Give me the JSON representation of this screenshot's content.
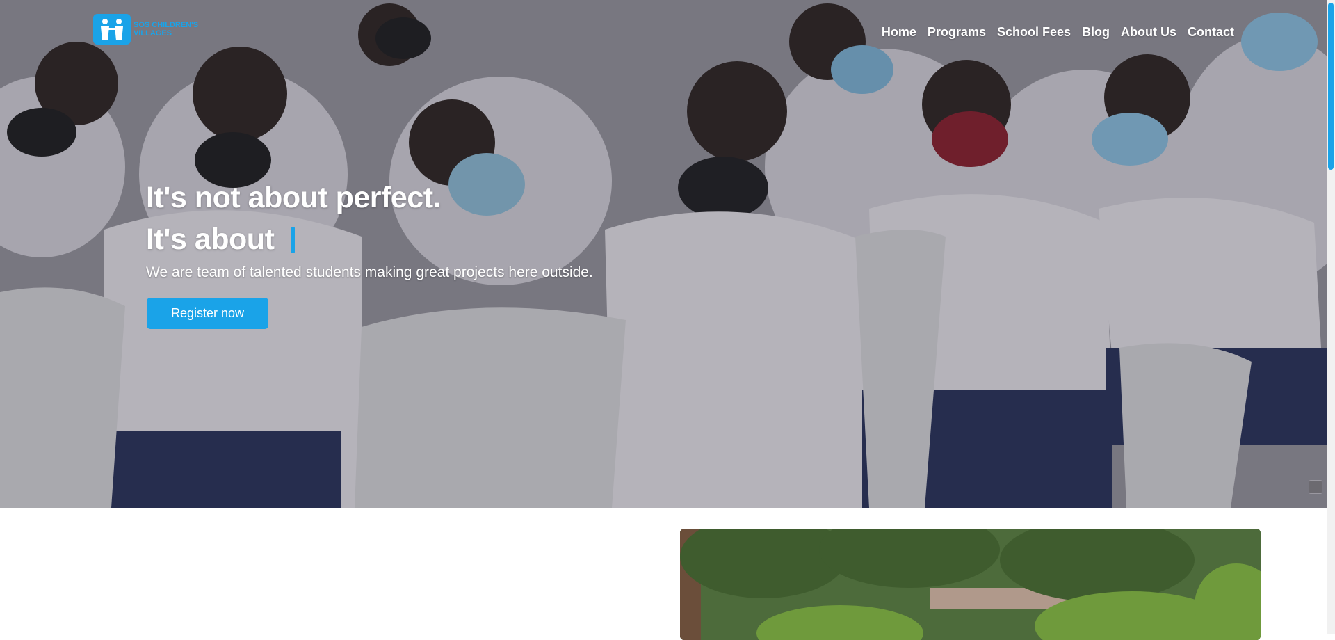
{
  "brand": {
    "name": "SOS CHILDREN'S VILLAGES",
    "accent": "#1aa3e8"
  },
  "nav": {
    "items": [
      "Home",
      "Programs",
      "School Fees",
      "Blog",
      "About Us",
      "Contact"
    ]
  },
  "hero": {
    "line1": "It's not about perfect.",
    "line2": "It's about",
    "subtitle": "We are team of talented students making great projects here outside.",
    "cta_label": "Register now"
  },
  "icons": {
    "logo": "children-logo-icon",
    "corner": "widget-icon"
  }
}
